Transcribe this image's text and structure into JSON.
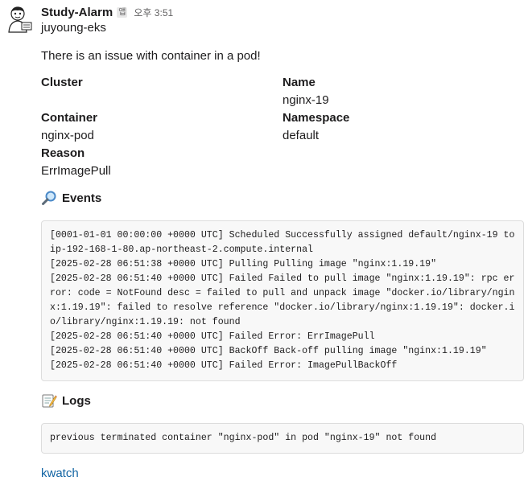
{
  "message": {
    "sender": "Study-Alarm",
    "app_badge": "앱",
    "time": "오후 3:51",
    "cluster_line": "juyoung-eks",
    "intro": "There is an issue with container in a pod!",
    "fields": {
      "cluster_label": "Cluster",
      "name_label": "Name",
      "name_value": "nginx-19",
      "container_label": "Container",
      "container_value": "nginx-pod",
      "namespace_label": "Namespace",
      "namespace_value": "default",
      "reason_label": "Reason",
      "reason_value": "ErrImagePull"
    },
    "events_title": "Events",
    "events": [
      "[0001-01-01 00:00:00 +0000 UTC] Scheduled Successfully assigned default/nginx-19 to ip-192-168-1-80.ap-northeast-2.compute.internal",
      "[2025-02-28 06:51:38 +0000 UTC] Pulling Pulling image \"nginx:1.19.19\"",
      "[2025-02-28 06:51:40 +0000 UTC] Failed Failed to pull image \"nginx:1.19.19\": rpc error: code = NotFound desc = failed to pull and unpack image \"docker.io/library/nginx:1.19.19\": failed to resolve reference \"docker.io/library/nginx:1.19.19\": docker.io/library/nginx:1.19.19: not found",
      "[2025-02-28 06:51:40 +0000 UTC] Failed Error: ErrImagePull",
      "[2025-02-28 06:51:40 +0000 UTC] BackOff Back-off pulling image \"nginx:1.19.19\"",
      "[2025-02-28 06:51:40 +0000 UTC] Failed Error: ImagePullBackOff"
    ],
    "logs_title": "Logs",
    "logs": "previous terminated container \"nginx-pod\" in pod \"nginx-19\" not found",
    "footer_link": "kwatch"
  },
  "icons": {
    "avatar": "cartoon-avatar-icon",
    "events": "magnifying-glass-icon",
    "logs": "memo-pencil-icon"
  },
  "colors": {
    "link": "#1264a3",
    "code_bg": "#f8f8f8",
    "code_border": "#dddddd"
  }
}
